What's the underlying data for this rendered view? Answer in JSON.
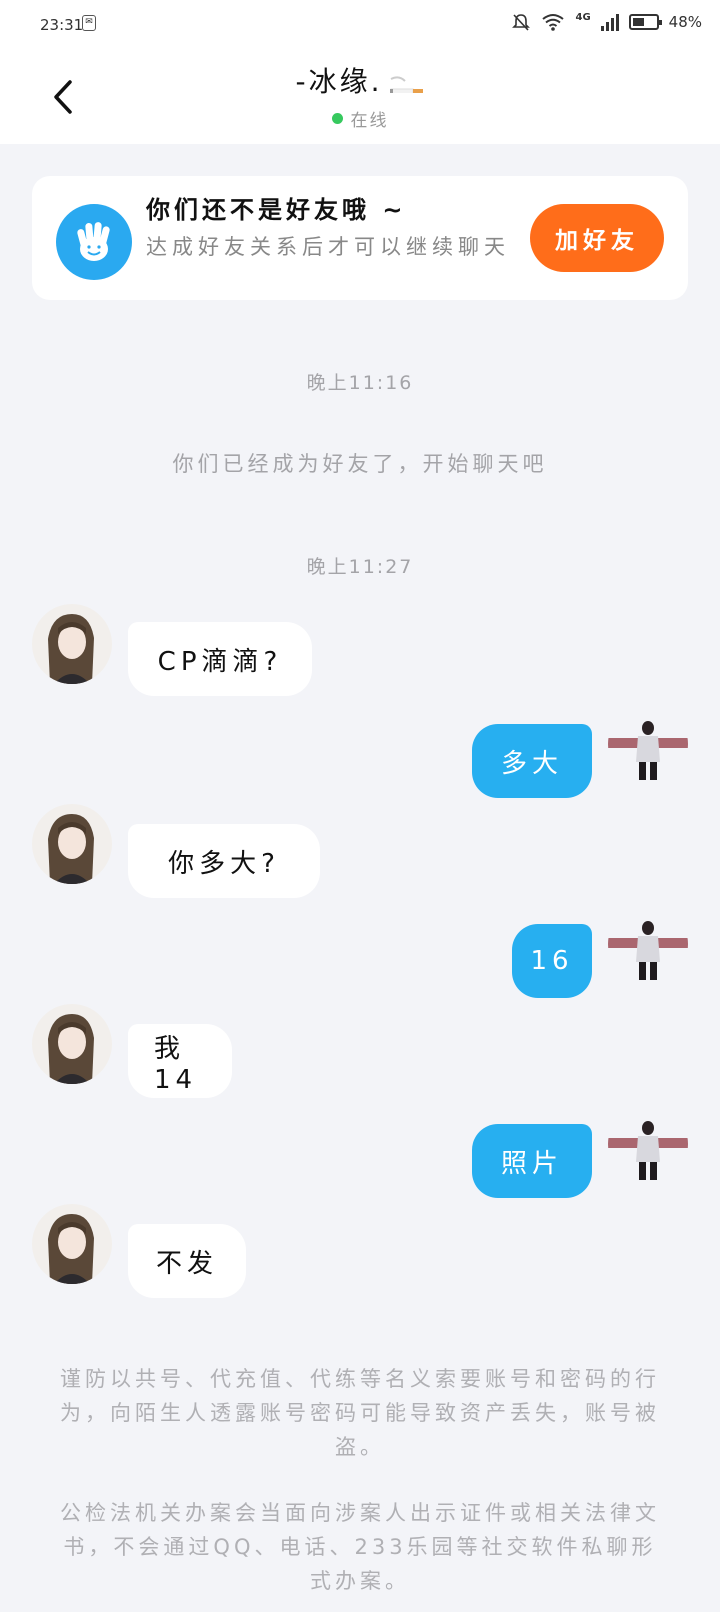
{
  "status": {
    "time": "23:31",
    "network": "4G",
    "battery": "48%",
    "battery_level": 0.48
  },
  "header": {
    "title": "-冰缘.",
    "status": "在线",
    "icons": {
      "back": "chevron-left-icon",
      "title_emoji": "cigarette-emoji-icon"
    }
  },
  "notice": {
    "title": "你们还不是好友哦 ~",
    "desc": "达成好友关系后才可以继续聊天",
    "button": "加好友",
    "icon": "waving-hand-icon",
    "accent": "#ff6d1a"
  },
  "chat": {
    "timestamp1": "晚上11:16",
    "system_msg": "你们已经成为好友了，开始聊天吧",
    "timestamp2": "晚上11:27",
    "messages": [
      {
        "side": "left",
        "text": "CP滴滴?"
      },
      {
        "side": "right",
        "text": "多大"
      },
      {
        "side": "left",
        "text": "你多大?"
      },
      {
        "side": "right",
        "text": "16"
      },
      {
        "side": "left",
        "text": "我14"
      },
      {
        "side": "right",
        "text": "照片"
      },
      {
        "side": "left",
        "text": "不发"
      }
    ],
    "colors": {
      "right_bubble": "#27aff0",
      "left_bubble": "#ffffff"
    }
  },
  "footer": {
    "warning1": "谨防以共号、代充值、代练等名义索要账号和密码的行为，向陌生人透露账号密码可能导致资产丢失，账号被盗。",
    "warning2": "公检法机关办案会当面向涉案人出示证件或相关法律文书，不会通过QQ、电话、233乐园等社交软件私聊形式办案。"
  }
}
